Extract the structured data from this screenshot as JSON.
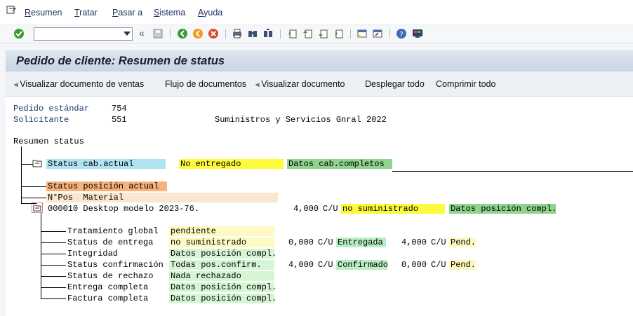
{
  "menu": {
    "items": [
      {
        "label": "Resumen",
        "key": "R"
      },
      {
        "label": "Tratar",
        "key": "T"
      },
      {
        "label": "Pasar a",
        "key": "P"
      },
      {
        "label": "Sistema",
        "key": "S"
      },
      {
        "label": "Ayuda",
        "key": "A"
      }
    ]
  },
  "toolbar": {
    "command_field_value": "",
    "icons": [
      "enter-icon",
      "back-double-icon",
      "save-icon",
      "back-icon",
      "exit-icon",
      "cancel-icon",
      "print-icon",
      "find-icon",
      "find-next-icon",
      "first-page-icon",
      "previous-page-icon",
      "next-page-icon",
      "last-page-icon",
      "create-session-icon",
      "shortcut-icon",
      "help-icon",
      "layout-icon"
    ]
  },
  "title": "Pedido de cliente: Resumen de status",
  "app_toolbar": {
    "display_sales_doc": "Visualizar documento de ventas",
    "doc_flow": "Flujo de documentos",
    "display_doc": "Visualizar documento",
    "expand_all": "Desplegar todo",
    "collapse_all": "Comprimir todo"
  },
  "header": {
    "doc_type_label": "Pedido estándar",
    "doc_number": "754",
    "sold_to_label": "Solicitante",
    "sold_to_number": "551",
    "sold_to_name": "Suministros y Servicios Gnral 2022"
  },
  "tree": {
    "root": "Resumen status",
    "header_status": {
      "label": "Status cab.actual",
      "delivery": "No entregado",
      "completeness": "Datos cab.completos"
    },
    "item_status_label": "Status posición actual",
    "columns": "N°Pos  Material",
    "item": {
      "line": "000010 Desktop modelo 2023-76.",
      "qty": "4,000",
      "unit": "C/U",
      "status": "no suministrado",
      "completeness": "Datos posición compl."
    },
    "details": [
      {
        "label": "Tratamiento global",
        "value": "pendiente",
        "color": "#fdf9c0"
      },
      {
        "label": "Status de entrega",
        "value": "no suministrado",
        "color": "#fdf9c0",
        "qty1": "0,000",
        "unit1": "C/U",
        "status1": "Entregada",
        "status1_color": "#b9eec3",
        "qty2": "4,000",
        "unit2": "C/U",
        "status2": "Pend.",
        "status2_color": "#fdf9c0"
      },
      {
        "label": "Integridad",
        "value": "Datos posición compl.",
        "color": "#d6f5d4"
      },
      {
        "label": "Status confirmación",
        "value": "Todas pos.confirm.",
        "color": "#d6f5d4",
        "qty1": "4,000",
        "unit1": "C/U",
        "status1": "Confirmado",
        "status1_color": "#b9eec3",
        "qty2": "0,000",
        "unit2": "C/U",
        "status2": "Pend.",
        "status2_color": "#fdf9c0"
      },
      {
        "label": "Status de rechazo",
        "value": "Nada rechazado",
        "color": "#d6f5d4"
      },
      {
        "label": "Entrega completa",
        "value": "Datos posición compl.",
        "color": "#d6f5d4"
      },
      {
        "label": "Factura completa",
        "value": "Datos posición compl.",
        "color": "#d6f5d4"
      }
    ]
  },
  "colors": {
    "header_status_bg": "#aee3f2",
    "yellow": "#fdfb3c",
    "green": "#8fd48d",
    "orange": "#f6b27a",
    "columns_bg": "#fbe7cf"
  }
}
